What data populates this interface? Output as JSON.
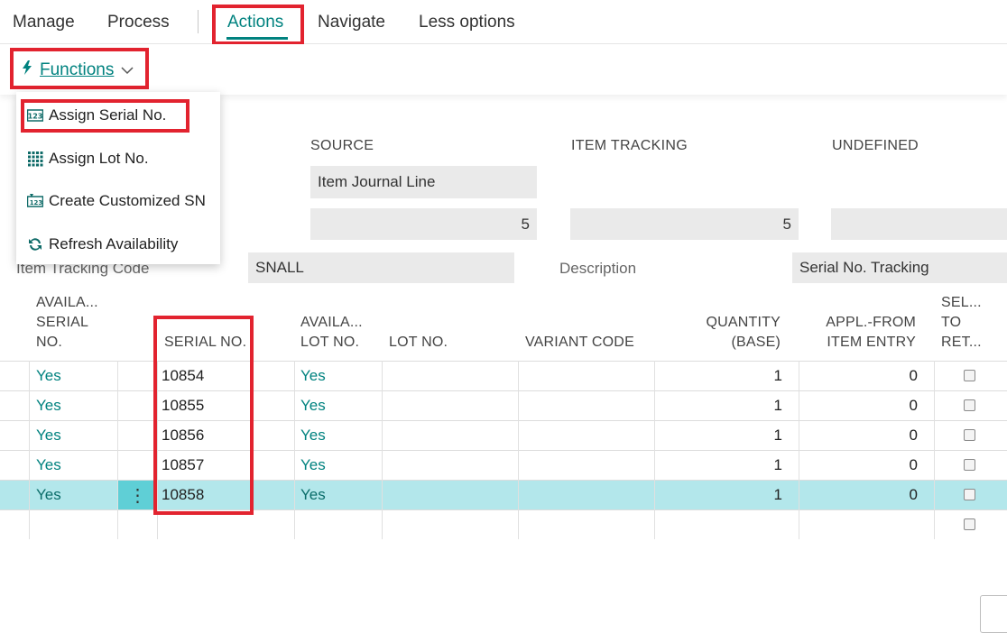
{
  "menu": {
    "items": [
      "Manage",
      "Process",
      "Actions",
      "Navigate",
      "Less options"
    ]
  },
  "subbar": {
    "functions_label": "Functions"
  },
  "dropdown": {
    "items": [
      {
        "label": "Assign Serial No.",
        "icon": "assign-serial-icon"
      },
      {
        "label": "Assign Lot No.",
        "icon": "assign-lot-icon"
      },
      {
        "label": "Create Customized SN",
        "icon": "create-sn-icon"
      },
      {
        "label": "Refresh Availability",
        "icon": "refresh-icon"
      }
    ]
  },
  "summary": {
    "source_header": "SOURCE",
    "item_tracking_header": "ITEM TRACKING",
    "undefined_header": "UNDEFINED",
    "source_value": "Item Journal Line",
    "source_qty": "5",
    "item_tracking_qty": "5"
  },
  "fields": {
    "item_tracking_code_label": "Item Tracking Code",
    "item_tracking_code_value": "SNALL",
    "description_label": "Description",
    "description_value": "Serial No. Tracking"
  },
  "table": {
    "headers": {
      "avail_serial": [
        "AVAILA...",
        "SERIAL",
        "NO."
      ],
      "serial_no": "SERIAL NO.",
      "avail_lot": [
        "AVAILA...",
        "LOT NO."
      ],
      "lot_no": "LOT NO.",
      "variant_code": "VARIANT CODE",
      "quantity": [
        "QUANTITY",
        "(BASE)"
      ],
      "appl_from": [
        "APPL.-FROM",
        "ITEM ENTRY"
      ],
      "sel_to_ret": [
        "SEL...",
        "TO",
        "RET..."
      ]
    },
    "rows": [
      {
        "avail_serial": "Yes",
        "serial_no": "10854",
        "avail_lot": "Yes",
        "quantity": "1",
        "appl_from": "0"
      },
      {
        "avail_serial": "Yes",
        "serial_no": "10855",
        "avail_lot": "Yes",
        "quantity": "1",
        "appl_from": "0"
      },
      {
        "avail_serial": "Yes",
        "serial_no": "10856",
        "avail_lot": "Yes",
        "quantity": "1",
        "appl_from": "0"
      },
      {
        "avail_serial": "Yes",
        "serial_no": "10857",
        "avail_lot": "Yes",
        "quantity": "1",
        "appl_from": "0"
      },
      {
        "avail_serial": "Yes",
        "serial_no": "10858",
        "avail_lot": "Yes",
        "quantity": "1",
        "appl_from": "0"
      }
    ],
    "row_actions_icon": "more-vertical-icon"
  },
  "colors": {
    "accent": "#00827f",
    "highlight": "#e2232f",
    "selected_row": "#b3e7eb"
  }
}
